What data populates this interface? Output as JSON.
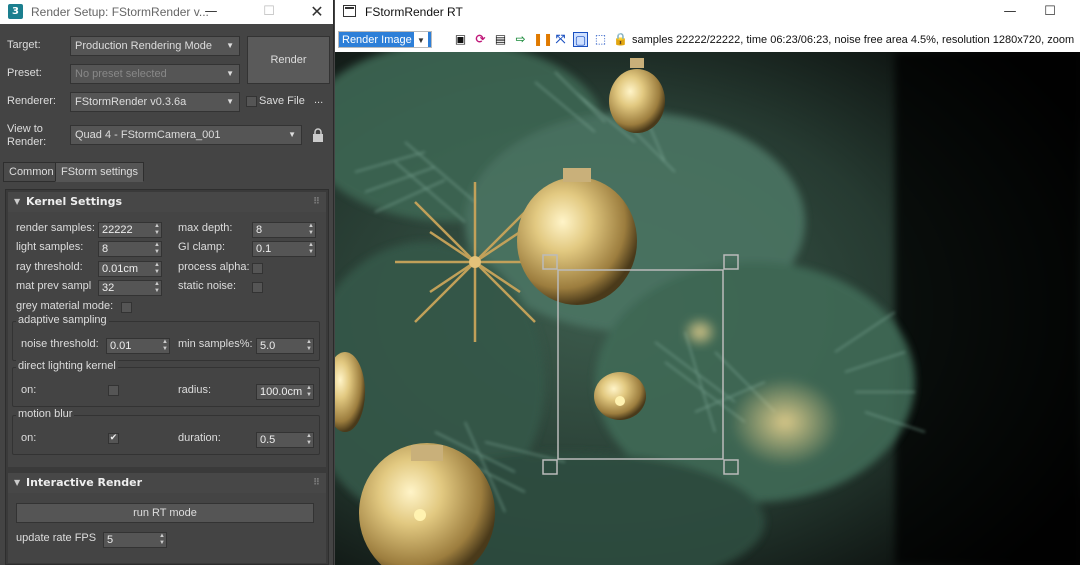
{
  "setup": {
    "app_icon": "3",
    "title": "Render Setup: FStormRender v...",
    "target_label": "Target:",
    "target_value": "Production Rendering Mode",
    "preset_label": "Preset:",
    "preset_value": "No preset selected",
    "renderer_label": "Renderer:",
    "renderer_value": "FStormRender v0.3.6a",
    "save_file_label": "Save File",
    "more_label": "...",
    "view_label": "View to\nRender:",
    "view_value": "Quad 4 - FStormCamera_001",
    "render_button": "Render",
    "tabs": [
      "Common",
      "FStorm settings"
    ]
  },
  "kernel": {
    "header": "Kernel Settings",
    "render_samples_label": "render samples:",
    "render_samples": "22222",
    "max_depth_label": "max depth:",
    "max_depth": "8",
    "light_samples_label": "light samples:",
    "light_samples": "8",
    "gi_clamp_label": "GI clamp:",
    "gi_clamp": "0.1",
    "ray_threshold_label": "ray threshold:",
    "ray_threshold": "0.01cm",
    "process_alpha_label": "process alpha:",
    "mat_prev_label": "mat prev sampl",
    "mat_prev": "32",
    "static_noise_label": "static noise:",
    "grey_material_label": "grey material mode:",
    "adaptive_title": "adaptive sampling",
    "noise_threshold_label": "noise threshold:",
    "noise_threshold": "0.01",
    "min_samples_label": "min samples%:",
    "min_samples": "5.0",
    "direct_title": "direct lighting kernel",
    "direct_on_label": "on:",
    "radius_label": "radius:",
    "radius": "100.0cm",
    "motion_title": "motion blur",
    "motion_on_label": "on:",
    "motion_on_check": "✔",
    "duration_label": "duration:",
    "duration": "0.5"
  },
  "interactive": {
    "header": "Interactive Render",
    "run_rt": "run RT mode",
    "update_rate_label": "update rate FPS",
    "update_rate": "5"
  },
  "rt": {
    "title": "FStormRender RT",
    "channel": "Render Image",
    "stats": "samples 22222/22222,  time 06:23/06:23,  noise free area 4.5%,  resolution 1280x720,  zoom",
    "icon_names": [
      "frame-icon",
      "refresh-icon",
      "save-icon",
      "export-icon",
      "pause-icon",
      "fit-icon",
      "region-icon",
      "crop-icon",
      "lock-icon"
    ]
  },
  "colors": {
    "accent": "#2d7fd8",
    "panel_bg": "#444444",
    "ornament_gold": "#d8c07a",
    "needle_green": "#2f5a47"
  }
}
